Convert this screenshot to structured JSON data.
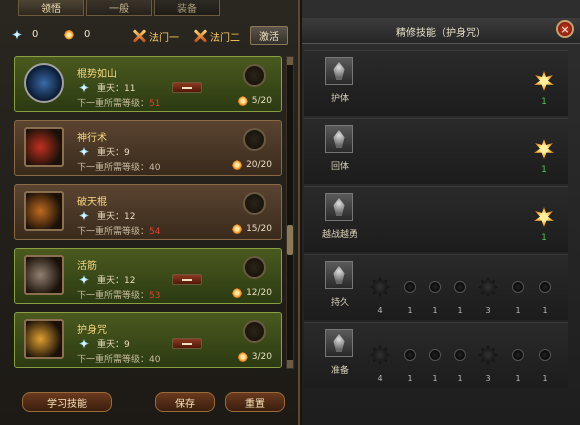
{
  "tabs": [
    "领悟",
    "一般",
    "装备"
  ],
  "stats": {
    "blue_value": "0",
    "orange_value": "0"
  },
  "magic_buttons": [
    "法门一",
    "法门二"
  ],
  "activate_label": "激活",
  "level_prefix": "重天：",
  "req_prefix": "下一重所需等级：",
  "skills": [
    {
      "name": "棍势如山",
      "level": "11",
      "req": "51",
      "progress": "5/20"
    },
    {
      "name": "神行术",
      "level": "9",
      "req": "40",
      "progress": "20/20"
    },
    {
      "name": "破天棍",
      "level": "12",
      "req": "54",
      "progress": "15/20"
    },
    {
      "name": "活筋",
      "level": "12",
      "req": "53",
      "progress": "12/20"
    },
    {
      "name": "护身咒",
      "level": "9",
      "req": "40",
      "progress": "3/20"
    }
  ],
  "bottom_buttons": [
    "学习技能",
    "保存",
    "重置"
  ],
  "refine_panel": {
    "title": "精修技能（护身咒）",
    "close": "×",
    "rows": [
      {
        "label": "护体",
        "count": "1"
      },
      {
        "label": "回体",
        "count": "1"
      },
      {
        "label": "越战越勇",
        "count": "1"
      },
      {
        "label": "持久",
        "dots": [
          "4",
          "1",
          "1",
          "1",
          "3",
          "1",
          "1"
        ]
      },
      {
        "label": "准备",
        "dots": [
          "4",
          "1",
          "1",
          "1",
          "3",
          "1",
          "1"
        ]
      }
    ]
  },
  "colors": {
    "accent_green": "#4a5a1e",
    "accent_brown": "#5a4430",
    "required_red": "#e04030",
    "count_green": "#4ac850"
  }
}
